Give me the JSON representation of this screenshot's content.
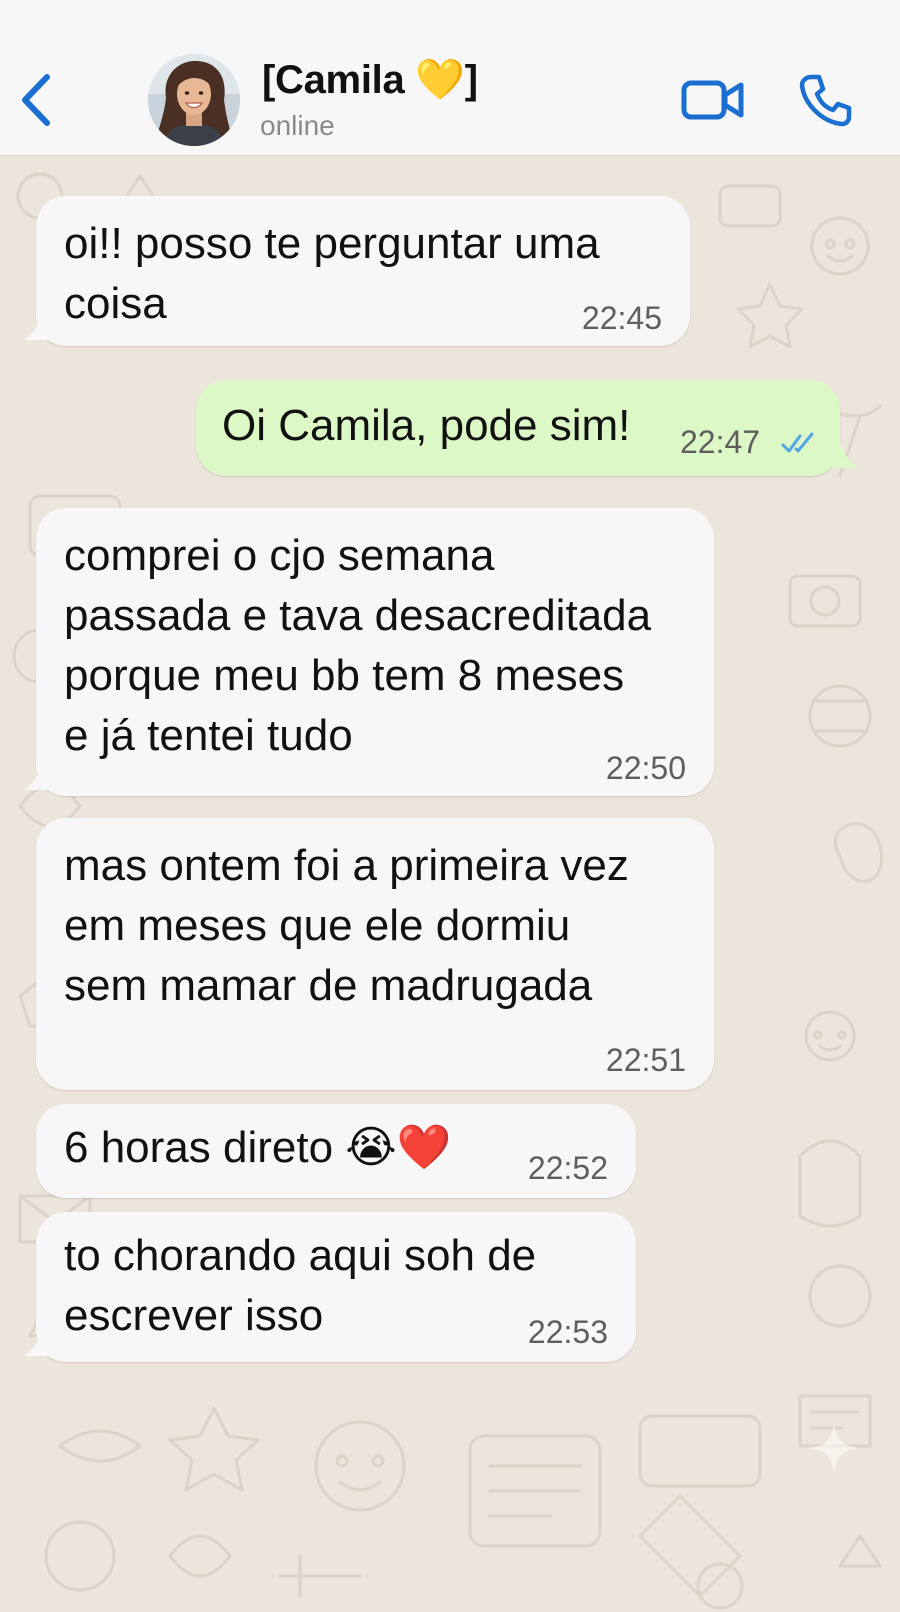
{
  "header": {
    "back_label": "back",
    "contact_name": "[Camila 💛]",
    "status": "online",
    "icons": {
      "back": "chevron-left-icon",
      "video": "video-camera-icon",
      "call": "phone-icon"
    },
    "accent_color": "#1b6fd1"
  },
  "messages": [
    {
      "direction": "incoming",
      "text": "oi!! posso te perguntar uma\ncoisa",
      "time": "22:45"
    },
    {
      "direction": "outgoing",
      "text": "Oi Camila, pode sim!",
      "time": "22:47",
      "status_icon": "double-check-read-icon"
    },
    {
      "direction": "incoming",
      "text": "comprei o cjo semana\npassada e tava desacreditada\nporque meu bb tem 8 meses\ne já tentei tudo",
      "time": "22:50"
    },
    {
      "direction": "incoming",
      "text": "mas ontem foi a primeira vez\nem meses que ele dormiu\nsem mamar de madrugada",
      "time": "22:51"
    },
    {
      "direction": "incoming",
      "text": "6 horas direto 😭❤️",
      "time": "22:52"
    },
    {
      "direction": "incoming",
      "text": "to chorando aqui soh de\nescrever isso",
      "time": "22:53"
    }
  ],
  "colors": {
    "chat_background": "#ece5dc",
    "incoming_bubble": "#f7f7f7",
    "outgoing_bubble": "#dcf8c6",
    "read_check": "#53a6e6"
  }
}
